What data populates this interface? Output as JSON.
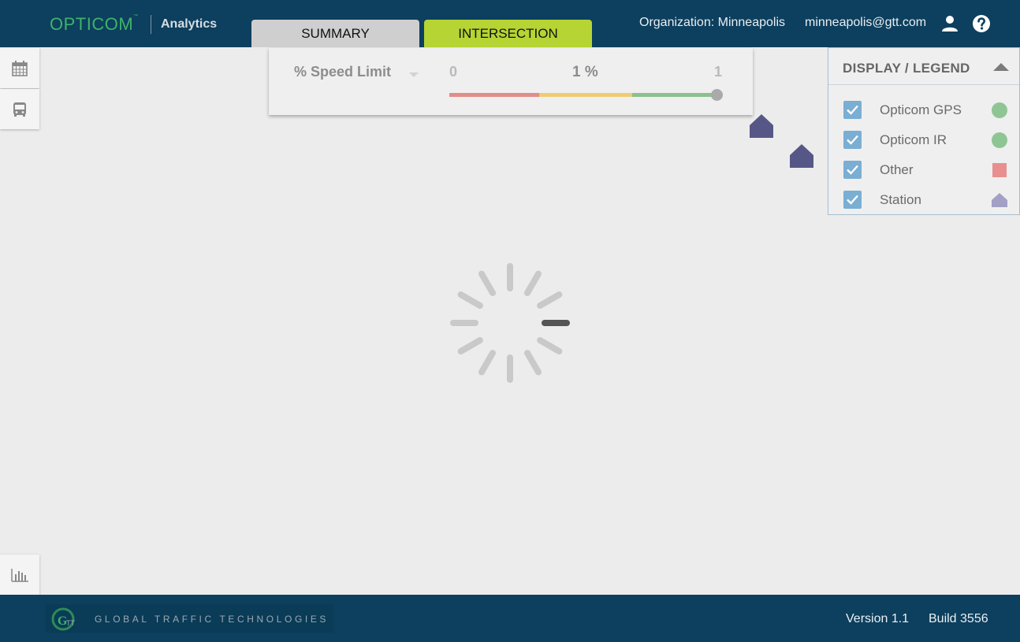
{
  "header": {
    "logo_text": "OPTICOM",
    "logo_sub": "Analytics",
    "tabs": [
      {
        "label": "SUMMARY",
        "active": false
      },
      {
        "label": "INTERSECTION",
        "active": true
      }
    ],
    "organization": "Organization: Minneapolis",
    "email": "minneapolis@gtt.com",
    "user_icon": "user-icon",
    "help_icon": "help-icon"
  },
  "sidebar": {
    "tools": [
      {
        "icon": "calendar-icon"
      },
      {
        "icon": "bus-icon"
      },
      {
        "icon": "bar-chart-icon"
      }
    ]
  },
  "speed_filter": {
    "metric": "% Speed Limit",
    "min": "0",
    "current": "1 %",
    "max": "1",
    "slider_value_fraction": 1.0
  },
  "legend": {
    "title": "DISPLAY / LEGEND",
    "items": [
      {
        "label": "Opticom GPS",
        "checked": true,
        "symbol": "circle",
        "color": "#8fc594"
      },
      {
        "label": "Opticom IR",
        "checked": true,
        "symbol": "circle",
        "color": "#8fc594"
      },
      {
        "label": "Other",
        "checked": true,
        "symbol": "square",
        "color": "#e98f8f"
      },
      {
        "label": "Station",
        "checked": true,
        "symbol": "house",
        "color": "#a3a0c6"
      }
    ]
  },
  "map": {
    "station_marker_color": "#575787",
    "loading": true
  },
  "footer": {
    "company": "GLOBAL TRAFFIC TECHNOLOGIES",
    "version": "Version 1.1",
    "build": "Build 3556"
  },
  "colors": {
    "header_bg": "#0d3f5e",
    "tab_active": "#b6d433",
    "tab_inactive": "#cfcfcf",
    "brand_green": "#3fb36a"
  }
}
